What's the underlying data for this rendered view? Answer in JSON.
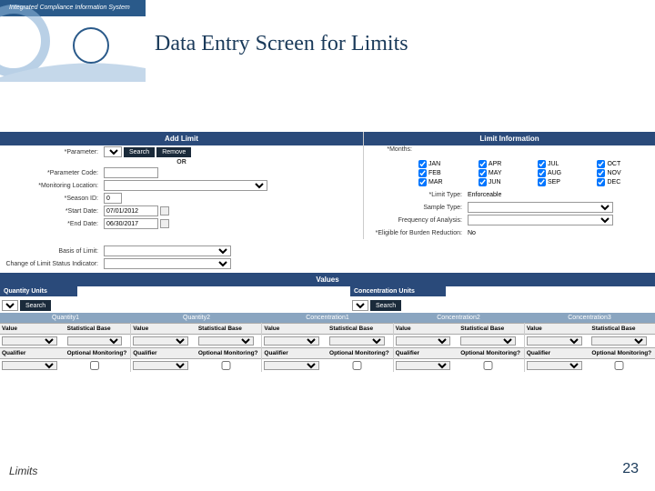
{
  "header_strip": "Integrated Compliance Information System",
  "title": "Data Entry Screen for Limits",
  "sections": {
    "add_limit": "Add Limit",
    "limit_info": "Limit Information",
    "values": "Values"
  },
  "labels": {
    "parameter": "*Parameter:",
    "or": "OR",
    "parameter_code": "*Parameter Code:",
    "monitoring_location": "*Monitoring Location:",
    "season_id": "*Season ID:",
    "start_date": "*Start Date:",
    "end_date": "*End Date:",
    "basis_of_limit": "Basis of Limit:",
    "change_indicator": "Change of Limit Status Indicator:",
    "months": "*Months:",
    "limit_type": "*Limit Type:",
    "sample_type": "Sample Type:",
    "frequency": "Frequency of Analysis:",
    "burden": "*Eligible for Burden Reduction:"
  },
  "buttons": {
    "search": "Search",
    "remove": "Remove"
  },
  "values": {
    "season_id": "0",
    "start_date": "07/01/2012",
    "end_date": "06/30/2017",
    "limit_type": "Enforceable",
    "burden": "No"
  },
  "months": [
    "JAN",
    "APR",
    "JUL",
    "OCT",
    "FEB",
    "MAY",
    "AUG",
    "NOV",
    "MAR",
    "JUN",
    "SEP",
    "DEC"
  ],
  "units": {
    "quantity": "Quantity Units",
    "concentration": "Concentration Units"
  },
  "qc_headers": [
    "Quantity1",
    "Quantity2",
    "Concentration1",
    "Concentration2",
    "Concentration3"
  ],
  "col_labels": {
    "value": "Value",
    "stat_base": "Statistical Base",
    "qualifier": "Qualifier",
    "opt_mon": "Optional Monitoring?"
  },
  "footer_label": "Limits",
  "footer_page": "23"
}
